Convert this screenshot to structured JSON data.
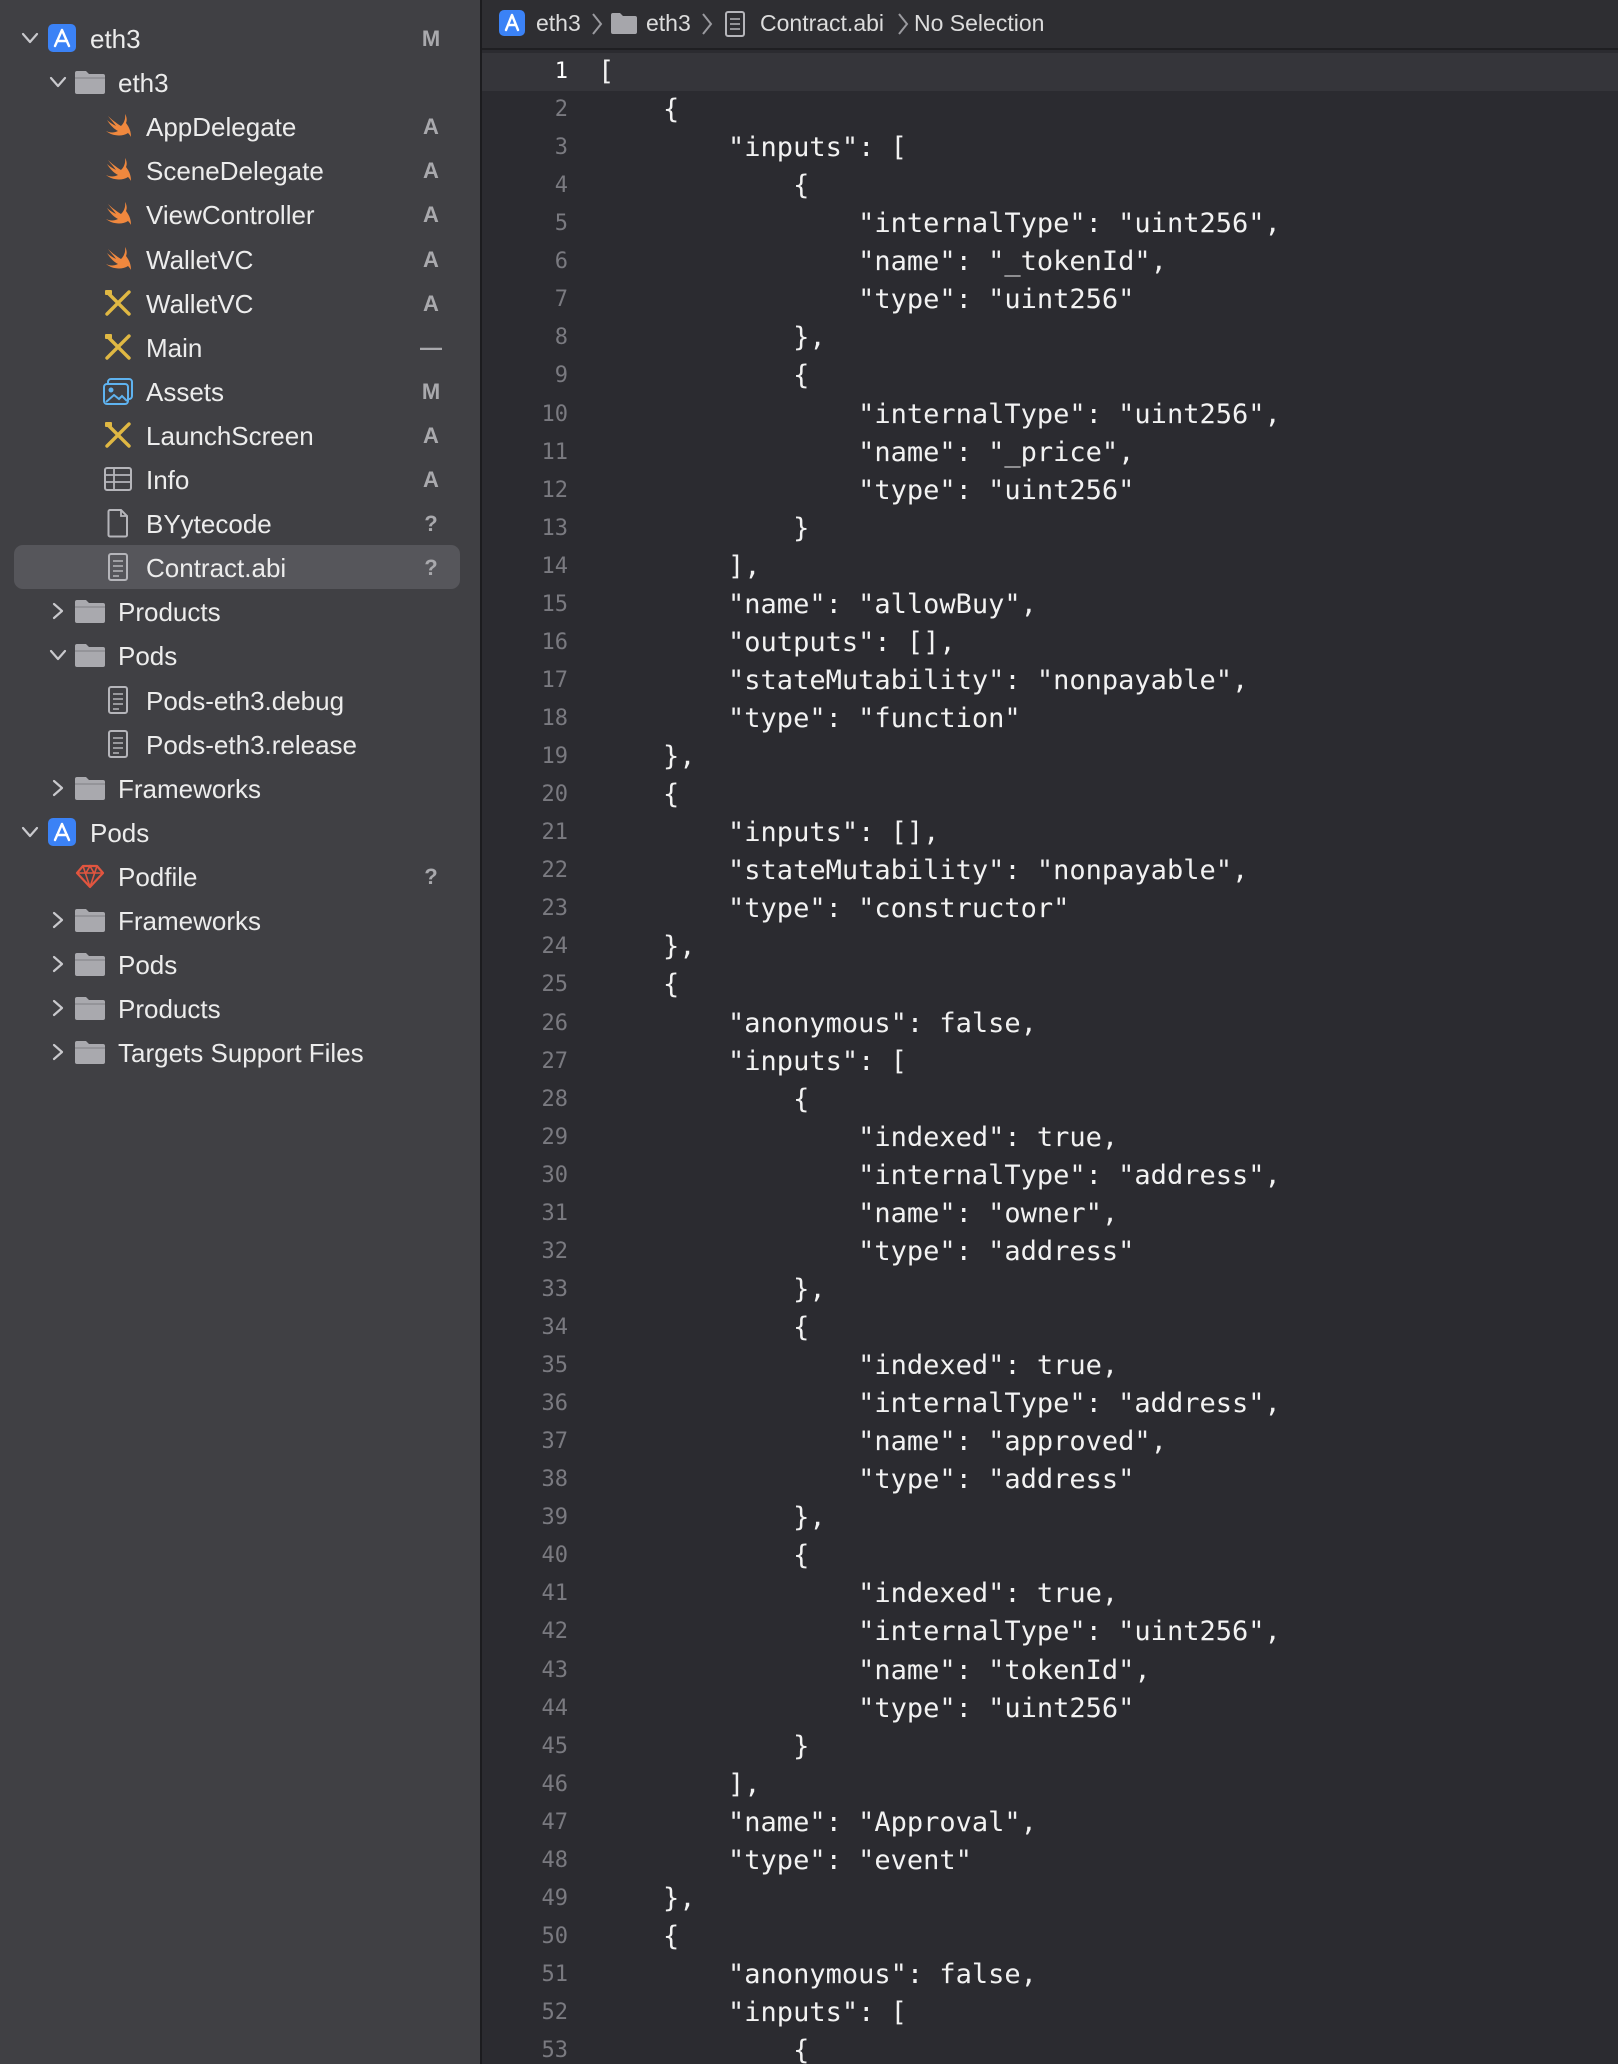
{
  "colors": {
    "sidebar_bg": "#404044",
    "editor_bg": "#2b2b30",
    "selection": "#56565b",
    "swift_orange": "#f0883e",
    "interface_yellow": "#e0b843",
    "project_blue": "#3b82f6"
  },
  "navigator": {
    "items": [
      {
        "label": "eth3",
        "status": "M",
        "icon": "xcode-project-icon",
        "indent": 0,
        "disclosure": "open"
      },
      {
        "label": "eth3",
        "status": "",
        "icon": "folder-icon",
        "indent": 1,
        "disclosure": "open"
      },
      {
        "label": "AppDelegate",
        "status": "A",
        "icon": "swift-file-icon",
        "indent": 2,
        "disclosure": "none"
      },
      {
        "label": "SceneDelegate",
        "status": "A",
        "icon": "swift-file-icon",
        "indent": 2,
        "disclosure": "none"
      },
      {
        "label": "ViewController",
        "status": "A",
        "icon": "swift-file-icon",
        "indent": 2,
        "disclosure": "none"
      },
      {
        "label": "WalletVC",
        "status": "A",
        "icon": "swift-file-icon",
        "indent": 2,
        "disclosure": "none"
      },
      {
        "label": "WalletVC",
        "status": "A",
        "icon": "interface-builder-icon",
        "indent": 2,
        "disclosure": "none"
      },
      {
        "label": "Main",
        "status": "—",
        "icon": "interface-builder-icon",
        "indent": 2,
        "disclosure": "none"
      },
      {
        "label": "Assets",
        "status": "M",
        "icon": "asset-catalog-icon",
        "indent": 2,
        "disclosure": "none"
      },
      {
        "label": "LaunchScreen",
        "status": "A",
        "icon": "interface-builder-icon",
        "indent": 2,
        "disclosure": "none"
      },
      {
        "label": "Info",
        "status": "A",
        "icon": "plist-table-icon",
        "indent": 2,
        "disclosure": "none"
      },
      {
        "label": "BYytecode",
        "status": "?",
        "icon": "blank-file-icon",
        "indent": 2,
        "disclosure": "none"
      },
      {
        "label": "Contract.abi",
        "status": "?",
        "icon": "text-file-icon",
        "indent": 2,
        "disclosure": "none",
        "selected": true
      },
      {
        "label": "Products",
        "status": "",
        "icon": "folder-icon",
        "indent": 1,
        "disclosure": "closed"
      },
      {
        "label": "Pods",
        "status": "",
        "icon": "folder-icon",
        "indent": 1,
        "disclosure": "open"
      },
      {
        "label": "Pods-eth3.debug",
        "status": "",
        "icon": "text-file-icon",
        "indent": 2,
        "disclosure": "none"
      },
      {
        "label": "Pods-eth3.release",
        "status": "",
        "icon": "text-file-icon",
        "indent": 2,
        "disclosure": "none"
      },
      {
        "label": "Frameworks",
        "status": "",
        "icon": "folder-icon",
        "indent": 1,
        "disclosure": "closed"
      },
      {
        "label": "Pods",
        "status": "",
        "icon": "xcode-project-icon",
        "indent": 0,
        "disclosure": "open"
      },
      {
        "label": "Podfile",
        "status": "?",
        "icon": "ruby-gem-icon",
        "indent": 1,
        "disclosure": "none"
      },
      {
        "label": "Frameworks",
        "status": "",
        "icon": "folder-icon",
        "indent": 1,
        "disclosure": "closed"
      },
      {
        "label": "Pods",
        "status": "",
        "icon": "folder-icon",
        "indent": 1,
        "disclosure": "closed"
      },
      {
        "label": "Products",
        "status": "",
        "icon": "folder-icon",
        "indent": 1,
        "disclosure": "closed"
      },
      {
        "label": "Targets Support Files",
        "status": "",
        "icon": "folder-icon",
        "indent": 1,
        "disclosure": "closed"
      }
    ]
  },
  "breadcrumb": {
    "project": "eth3",
    "group": "eth3",
    "file": "Contract.abi",
    "selection": "No Selection"
  },
  "editor": {
    "active_line": 1,
    "lines": [
      "[",
      "    {",
      "        \"inputs\": [",
      "            {",
      "                \"internalType\": \"uint256\",",
      "                \"name\": \"_tokenId\",",
      "                \"type\": \"uint256\"",
      "            },",
      "            {",
      "                \"internalType\": \"uint256\",",
      "                \"name\": \"_price\",",
      "                \"type\": \"uint256\"",
      "            }",
      "        ],",
      "        \"name\": \"allowBuy\",",
      "        \"outputs\": [],",
      "        \"stateMutability\": \"nonpayable\",",
      "        \"type\": \"function\"",
      "    },",
      "    {",
      "        \"inputs\": [],",
      "        \"stateMutability\": \"nonpayable\",",
      "        \"type\": \"constructor\"",
      "    },",
      "    {",
      "        \"anonymous\": false,",
      "        \"inputs\": [",
      "            {",
      "                \"indexed\": true,",
      "                \"internalType\": \"address\",",
      "                \"name\": \"owner\",",
      "                \"type\": \"address\"",
      "            },",
      "            {",
      "                \"indexed\": true,",
      "                \"internalType\": \"address\",",
      "                \"name\": \"approved\",",
      "                \"type\": \"address\"",
      "            },",
      "            {",
      "                \"indexed\": true,",
      "                \"internalType\": \"uint256\",",
      "                \"name\": \"tokenId\",",
      "                \"type\": \"uint256\"",
      "            }",
      "        ],",
      "        \"name\": \"Approval\",",
      "        \"type\": \"event\"",
      "    },",
      "    {",
      "        \"anonymous\": false,",
      "        \"inputs\": [",
      "            {"
    ]
  }
}
